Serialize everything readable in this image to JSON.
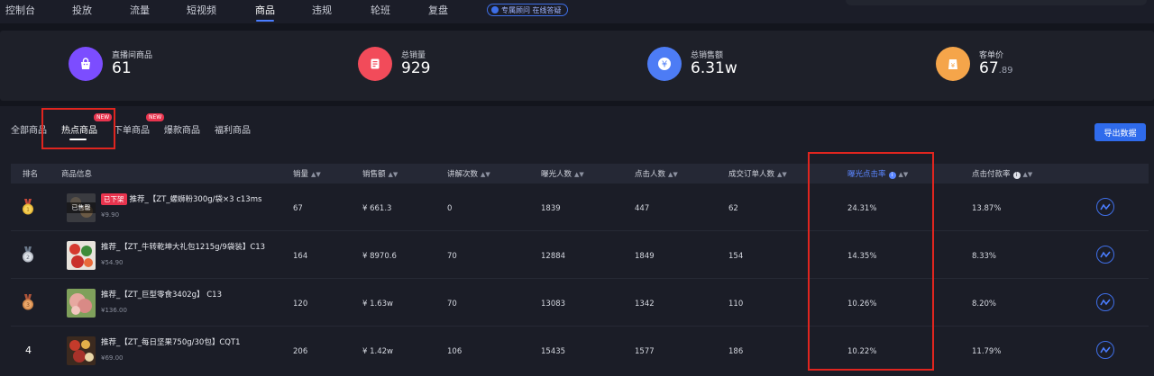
{
  "nav": {
    "items": [
      "控制台",
      "投放",
      "流量",
      "短视频",
      "商品",
      "违规",
      "轮班",
      "复盘"
    ],
    "active_index": 4,
    "advisor": "专属顾问 在线答疑"
  },
  "stats": [
    {
      "label": "直播间商品",
      "value": "61",
      "decimal": "",
      "icon": "shopping-bag-icon",
      "color": "#7c4dff"
    },
    {
      "label": "总销量",
      "value": "929",
      "decimal": "",
      "icon": "document-icon",
      "color": "#f24b5a"
    },
    {
      "label": "总销售额",
      "value": "6.31w",
      "decimal": "",
      "icon": "yen-icon",
      "color": "#4d7cf5"
    },
    {
      "label": "客单价",
      "value": "67",
      "decimal": ".89",
      "icon": "price-tag-icon",
      "color": "#f5a54a"
    }
  ],
  "subtabs": {
    "items": [
      "全部商品",
      "热点商品",
      "下单商品",
      "爆款商品",
      "福利商品"
    ],
    "active_index": 1,
    "new_badge": "NEW"
  },
  "export_label": "导出数据",
  "table": {
    "headers": {
      "rank": "排名",
      "product": "商品信息",
      "sales": "销量",
      "revenue": "销售额",
      "explain": "讲解次数",
      "exposure": "曝光人数",
      "clicks": "点击人数",
      "orders": "成交订单人数",
      "ctr": "曝光点击率",
      "cvr": "点击付款率"
    },
    "rows": [
      {
        "rank": "1",
        "medal": "gold",
        "tag": "已下架",
        "thumb_label": "已售罄",
        "name": "推荐_【ZT_螺蛳粉300g/袋×3 c13ms",
        "price": "¥9.90",
        "sales": "67",
        "revenue": "¥ 661.3",
        "explain": "0",
        "exposure": "1839",
        "clicks": "447",
        "orders": "62",
        "ctr": "24.31%",
        "cvr": "13.87%"
      },
      {
        "rank": "2",
        "medal": "silver",
        "tag": "",
        "thumb_label": "",
        "name": "推荐_【ZT_牛转乾坤大礼包1215g/9袋装】C13",
        "price": "¥54.90",
        "sales": "164",
        "revenue": "¥ 8970.6",
        "explain": "70",
        "exposure": "12884",
        "clicks": "1849",
        "orders": "154",
        "ctr": "14.35%",
        "cvr": "8.33%"
      },
      {
        "rank": "3",
        "medal": "bronze",
        "tag": "",
        "thumb_label": "",
        "name": "推荐_【ZT_巨型零食3402g】 C13",
        "price": "¥136.00",
        "sales": "120",
        "revenue": "¥ 1.63w",
        "explain": "70",
        "exposure": "13083",
        "clicks": "1342",
        "orders": "110",
        "ctr": "10.26%",
        "cvr": "8.20%"
      },
      {
        "rank": "4",
        "medal": "",
        "tag": "",
        "thumb_label": "",
        "name": "推荐_【ZT_每日坚果750g/30包】CQT1",
        "price": "¥69.00",
        "sales": "206",
        "revenue": "¥ 1.42w",
        "explain": "106",
        "exposure": "15435",
        "clicks": "1577",
        "orders": "186",
        "ctr": "10.22%",
        "cvr": "11.79%"
      }
    ]
  }
}
